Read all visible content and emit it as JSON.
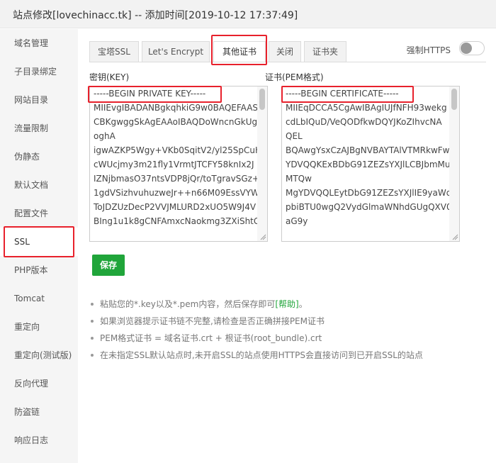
{
  "window": {
    "title": "站点修改[lovechinacc.tk] -- 添加时间[2019-10-12 17:37:49]"
  },
  "sidebar": {
    "items": [
      {
        "label": "域名管理"
      },
      {
        "label": "子目录绑定"
      },
      {
        "label": "网站目录"
      },
      {
        "label": "流量限制"
      },
      {
        "label": "伪静态"
      },
      {
        "label": "默认文档"
      },
      {
        "label": "配置文件"
      },
      {
        "label": "SSL",
        "active": true
      },
      {
        "label": "PHP版本"
      },
      {
        "label": "Tomcat"
      },
      {
        "label": "重定向"
      },
      {
        "label": "重定向(测试版)"
      },
      {
        "label": "反向代理"
      },
      {
        "label": "防盗链"
      },
      {
        "label": "响应日志"
      }
    ]
  },
  "tabs": [
    {
      "label": "宝塔SSL"
    },
    {
      "label": "Let's Encrypt"
    },
    {
      "label": "其他证书",
      "active": true
    },
    {
      "label": "关闭"
    },
    {
      "label": "证书夹"
    }
  ],
  "https_toggle": {
    "label": "强制HTTPS",
    "enabled": false
  },
  "key_field": {
    "label": "密钥(KEY)",
    "lines": [
      "-----BEGIN PRIVATE KEY-----",
      "MIIEvgIBADANBgkqhkiG9w0BAQEFAAS",
      "CBKgwggSkAgEAAoIBAQDoWncnGkUg",
      "oghA",
      "igwAZKP5Wgy+VKb0SqitV2/yl25SpCuH",
      "cWUcjmy3m21fly1VrmtJTCFY58knIx2J",
      "IZNjbmasO37ntsVDP8jQr/toTgravSGz+",
      "1gdVSizhvuhuzweJr++n66M09EssVYW",
      "ToJDZUzDecP2VVJMLURD2xUO5W9J4V",
      "BIng1u1k8gCNFAmxcNaokmg3ZXiShtG"
    ]
  },
  "cert_field": {
    "label": "证书(PEM格式)",
    "lines": [
      "-----BEGIN CERTIFICATE-----",
      "MIIEqDCCA5CgAwIBAgIUJfNFH93wekg",
      "cdLbIQuD/VeQODfkwDQYJKoZIhvcNA",
      "QEL",
      "BQAwgYsxCzAJBgNVBAYTAlVTMRkwFw",
      "YDVQQKExBDbG91ZEZsYXJlLCBJbmMu",
      "MTQw",
      "MgYDVQQLEytDbG91ZEZsYXJlIE9yaWd",
      "pbiBTU0wgQ2VydGlmaWNhdGUgQXV0",
      "aG9y"
    ]
  },
  "save_button": {
    "label": "保存"
  },
  "notes": {
    "note1_text": "粘贴您的*.key以及*.pem内容，然后保存即可",
    "note1_link": "[帮助]",
    "note1_end": "。",
    "note2": "如果浏览器提示证书链不完整,请检查是否正确拼接PEM证书",
    "note3": "PEM格式证书 = 域名证书.crt + 根证书(root_bundle).crt",
    "note4": "在未指定SSL默认站点时,未开启SSL的站点使用HTTPS会直接访问到已开启SSL的站点"
  },
  "colors": {
    "accent_green": "#20a53a",
    "highlight_red": "#e8212c"
  }
}
